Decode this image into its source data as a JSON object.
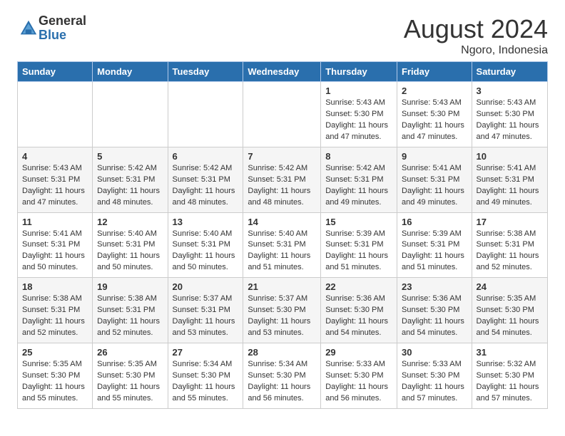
{
  "logo": {
    "general": "General",
    "blue": "Blue"
  },
  "title": "August 2024",
  "location": "Ngoro, Indonesia",
  "weekdays": [
    "Sunday",
    "Monday",
    "Tuesday",
    "Wednesday",
    "Thursday",
    "Friday",
    "Saturday"
  ],
  "weeks": [
    [
      {
        "day": "",
        "info": ""
      },
      {
        "day": "",
        "info": ""
      },
      {
        "day": "",
        "info": ""
      },
      {
        "day": "",
        "info": ""
      },
      {
        "day": "1",
        "info": "Sunrise: 5:43 AM\nSunset: 5:30 PM\nDaylight: 11 hours and 47 minutes."
      },
      {
        "day": "2",
        "info": "Sunrise: 5:43 AM\nSunset: 5:30 PM\nDaylight: 11 hours and 47 minutes."
      },
      {
        "day": "3",
        "info": "Sunrise: 5:43 AM\nSunset: 5:30 PM\nDaylight: 11 hours and 47 minutes."
      }
    ],
    [
      {
        "day": "4",
        "info": "Sunrise: 5:43 AM\nSunset: 5:31 PM\nDaylight: 11 hours and 47 minutes."
      },
      {
        "day": "5",
        "info": "Sunrise: 5:42 AM\nSunset: 5:31 PM\nDaylight: 11 hours and 48 minutes."
      },
      {
        "day": "6",
        "info": "Sunrise: 5:42 AM\nSunset: 5:31 PM\nDaylight: 11 hours and 48 minutes."
      },
      {
        "day": "7",
        "info": "Sunrise: 5:42 AM\nSunset: 5:31 PM\nDaylight: 11 hours and 48 minutes."
      },
      {
        "day": "8",
        "info": "Sunrise: 5:42 AM\nSunset: 5:31 PM\nDaylight: 11 hours and 49 minutes."
      },
      {
        "day": "9",
        "info": "Sunrise: 5:41 AM\nSunset: 5:31 PM\nDaylight: 11 hours and 49 minutes."
      },
      {
        "day": "10",
        "info": "Sunrise: 5:41 AM\nSunset: 5:31 PM\nDaylight: 11 hours and 49 minutes."
      }
    ],
    [
      {
        "day": "11",
        "info": "Sunrise: 5:41 AM\nSunset: 5:31 PM\nDaylight: 11 hours and 50 minutes."
      },
      {
        "day": "12",
        "info": "Sunrise: 5:40 AM\nSunset: 5:31 PM\nDaylight: 11 hours and 50 minutes."
      },
      {
        "day": "13",
        "info": "Sunrise: 5:40 AM\nSunset: 5:31 PM\nDaylight: 11 hours and 50 minutes."
      },
      {
        "day": "14",
        "info": "Sunrise: 5:40 AM\nSunset: 5:31 PM\nDaylight: 11 hours and 51 minutes."
      },
      {
        "day": "15",
        "info": "Sunrise: 5:39 AM\nSunset: 5:31 PM\nDaylight: 11 hours and 51 minutes."
      },
      {
        "day": "16",
        "info": "Sunrise: 5:39 AM\nSunset: 5:31 PM\nDaylight: 11 hours and 51 minutes."
      },
      {
        "day": "17",
        "info": "Sunrise: 5:38 AM\nSunset: 5:31 PM\nDaylight: 11 hours and 52 minutes."
      }
    ],
    [
      {
        "day": "18",
        "info": "Sunrise: 5:38 AM\nSunset: 5:31 PM\nDaylight: 11 hours and 52 minutes."
      },
      {
        "day": "19",
        "info": "Sunrise: 5:38 AM\nSunset: 5:31 PM\nDaylight: 11 hours and 52 minutes."
      },
      {
        "day": "20",
        "info": "Sunrise: 5:37 AM\nSunset: 5:31 PM\nDaylight: 11 hours and 53 minutes."
      },
      {
        "day": "21",
        "info": "Sunrise: 5:37 AM\nSunset: 5:30 PM\nDaylight: 11 hours and 53 minutes."
      },
      {
        "day": "22",
        "info": "Sunrise: 5:36 AM\nSunset: 5:30 PM\nDaylight: 11 hours and 54 minutes."
      },
      {
        "day": "23",
        "info": "Sunrise: 5:36 AM\nSunset: 5:30 PM\nDaylight: 11 hours and 54 minutes."
      },
      {
        "day": "24",
        "info": "Sunrise: 5:35 AM\nSunset: 5:30 PM\nDaylight: 11 hours and 54 minutes."
      }
    ],
    [
      {
        "day": "25",
        "info": "Sunrise: 5:35 AM\nSunset: 5:30 PM\nDaylight: 11 hours and 55 minutes."
      },
      {
        "day": "26",
        "info": "Sunrise: 5:35 AM\nSunset: 5:30 PM\nDaylight: 11 hours and 55 minutes."
      },
      {
        "day": "27",
        "info": "Sunrise: 5:34 AM\nSunset: 5:30 PM\nDaylight: 11 hours and 55 minutes."
      },
      {
        "day": "28",
        "info": "Sunrise: 5:34 AM\nSunset: 5:30 PM\nDaylight: 11 hours and 56 minutes."
      },
      {
        "day": "29",
        "info": "Sunrise: 5:33 AM\nSunset: 5:30 PM\nDaylight: 11 hours and 56 minutes."
      },
      {
        "day": "30",
        "info": "Sunrise: 5:33 AM\nSunset: 5:30 PM\nDaylight: 11 hours and 57 minutes."
      },
      {
        "day": "31",
        "info": "Sunrise: 5:32 AM\nSunset: 5:30 PM\nDaylight: 11 hours and 57 minutes."
      }
    ]
  ]
}
